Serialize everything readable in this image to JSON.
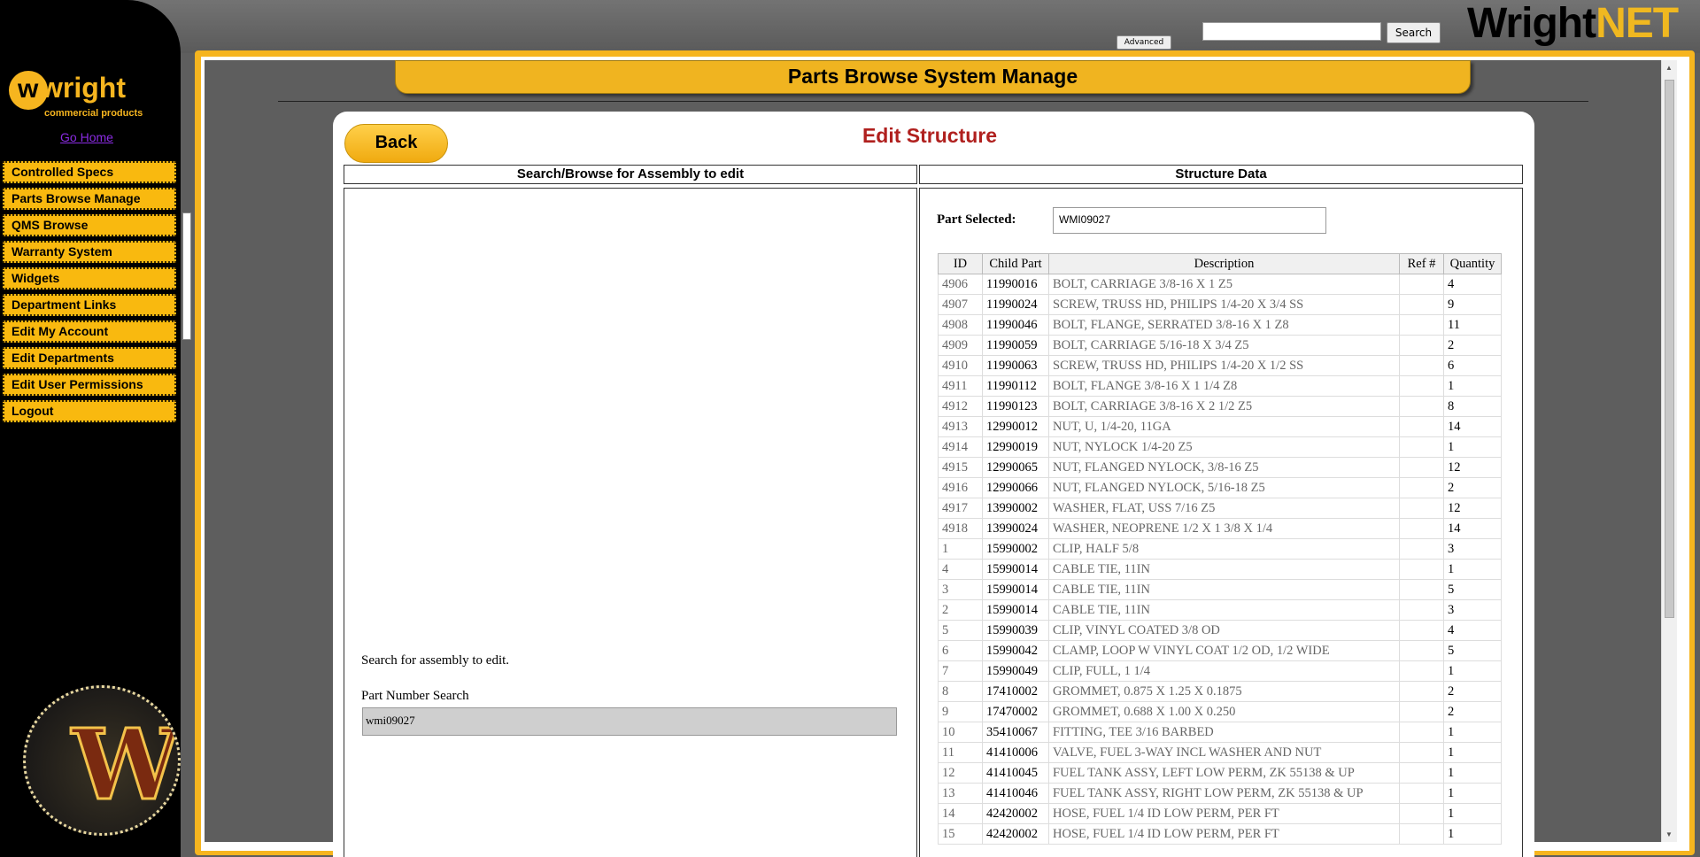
{
  "header": {
    "search_placeholder": "",
    "search_button": "Search",
    "advanced_button": "Advanced",
    "brand_part1": "Wright",
    "brand_part2": "NET"
  },
  "sidebar": {
    "logo_text": "wright",
    "logo_sub": "commercial products",
    "go_home": "Go Home",
    "items": [
      {
        "label": "Controlled Specs"
      },
      {
        "label": "Parts Browse Manage"
      },
      {
        "label": "QMS Browse"
      },
      {
        "label": "Warranty System"
      },
      {
        "label": "Widgets"
      },
      {
        "label": "Department Links"
      },
      {
        "label": "Edit My Account"
      },
      {
        "label": "Edit Departments"
      },
      {
        "label": "Edit User Permissions"
      },
      {
        "label": "Logout"
      }
    ]
  },
  "main": {
    "page_title": "Parts Browse System Manage",
    "back_button": "Back",
    "edit_title": "Edit Structure",
    "left_heading": "Search/Browse for Assembly to edit",
    "right_heading": "Structure Data",
    "search_note": "Search for assembly to edit.",
    "part_number_label": "Part Number Search",
    "part_number_value": "wmi09027",
    "part_selected_label": "Part Selected:",
    "part_selected_value": "WMI09027"
  },
  "table": {
    "columns": [
      "ID",
      "Child Part",
      "Description",
      "Ref #",
      "Quantity"
    ],
    "rows": [
      [
        "4906",
        "11990016",
        "BOLT, CARRIAGE 3/8-16 X 1 Z5",
        "",
        "4"
      ],
      [
        "4907",
        "11990024",
        "SCREW, TRUSS HD, PHILIPS 1/4-20 X 3/4 SS",
        "",
        "9"
      ],
      [
        "4908",
        "11990046",
        "BOLT, FLANGE, SERRATED 3/8-16 X 1 Z8",
        "",
        "11"
      ],
      [
        "4909",
        "11990059",
        "BOLT, CARRIAGE 5/16-18 X 3/4 Z5",
        "",
        "2"
      ],
      [
        "4910",
        "11990063",
        "SCREW, TRUSS HD, PHILIPS 1/4-20 X 1/2 SS",
        "",
        "6"
      ],
      [
        "4911",
        "11990112",
        "BOLT, FLANGE 3/8-16 X 1 1/4 Z8",
        "",
        "1"
      ],
      [
        "4912",
        "11990123",
        "BOLT, CARRIAGE 3/8-16 X 2 1/2 Z5",
        "",
        "8"
      ],
      [
        "4913",
        "12990012",
        "NUT, U, 1/4-20, 11GA",
        "",
        "14"
      ],
      [
        "4914",
        "12990019",
        "NUT, NYLOCK 1/4-20 Z5",
        "",
        "1"
      ],
      [
        "4915",
        "12990065",
        "NUT, FLANGED NYLOCK, 3/8-16 Z5",
        "",
        "12"
      ],
      [
        "4916",
        "12990066",
        "NUT, FLANGED NYLOCK, 5/16-18 Z5",
        "",
        "2"
      ],
      [
        "4917",
        "13990002",
        "WASHER, FLAT, USS 7/16 Z5",
        "",
        "12"
      ],
      [
        "4918",
        "13990024",
        "WASHER, NEOPRENE 1/2 X 1 3/8 X 1/4",
        "",
        "14"
      ],
      [
        "1",
        "15990002",
        "CLIP, HALF 5/8",
        "",
        "3"
      ],
      [
        "4",
        "15990014",
        "CABLE TIE, 11IN",
        "",
        "1"
      ],
      [
        "3",
        "15990014",
        "CABLE TIE, 11IN",
        "",
        "5"
      ],
      [
        "2",
        "15990014",
        "CABLE TIE, 11IN",
        "",
        "3"
      ],
      [
        "5",
        "15990039",
        "CLIP, VINYL COATED 3/8 OD",
        "",
        "4"
      ],
      [
        "6",
        "15990042",
        "CLAMP, LOOP W VINYL COAT 1/2 OD, 1/2 WIDE",
        "",
        "5"
      ],
      [
        "7",
        "15990049",
        "CLIP, FULL, 1 1/4",
        "",
        "1"
      ],
      [
        "8",
        "17410002",
        "GROMMET, 0.875 X 1.25 X 0.1875",
        "",
        "2"
      ],
      [
        "9",
        "17470002",
        "GROMMET, 0.688 X 1.00 X 0.250",
        "",
        "2"
      ],
      [
        "10",
        "35410067",
        "FITTING, TEE 3/16 BARBED",
        "",
        "1"
      ],
      [
        "11",
        "41410006",
        "VALVE, FUEL 3-WAY INCL WASHER AND NUT",
        "",
        "1"
      ],
      [
        "12",
        "41410045",
        "FUEL TANK ASSY, LEFT LOW PERM, ZK 55138 & UP",
        "",
        "1"
      ],
      [
        "13",
        "41410046",
        "FUEL TANK ASSY, RIGHT LOW PERM, ZK 55138 & UP",
        "",
        "1"
      ],
      [
        "14",
        "42420002",
        "HOSE, FUEL 1/4 ID LOW PERM, PER FT",
        "",
        "1"
      ],
      [
        "15",
        "42420002",
        "HOSE, FUEL 1/4 ID LOW PERM, PER FT",
        "",
        "1"
      ]
    ]
  },
  "colors": {
    "accent": "#f0b420",
    "title_red": "#b0201e",
    "background": "#5e5e5e"
  }
}
